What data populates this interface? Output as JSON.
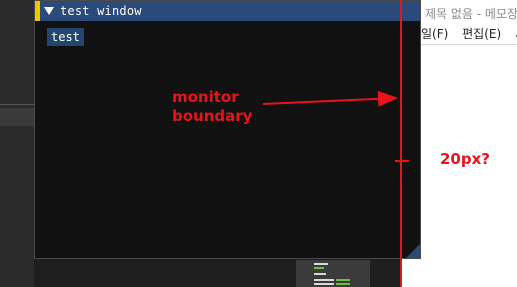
{
  "window": {
    "title": "test window",
    "button_label": "test",
    "accent_color": "#f5c400",
    "titlebar_color": "#294a7a",
    "icon": "collapse-triangle-icon"
  },
  "notepad": {
    "title": "제목 없음 - 메모장",
    "menu": [
      "일(F)",
      "편집(E)",
      "서"
    ]
  },
  "annotations": {
    "monitor_line1": "monitor",
    "monitor_line2": "boundary",
    "gap_label": "20px?",
    "color": "#e8141c"
  }
}
